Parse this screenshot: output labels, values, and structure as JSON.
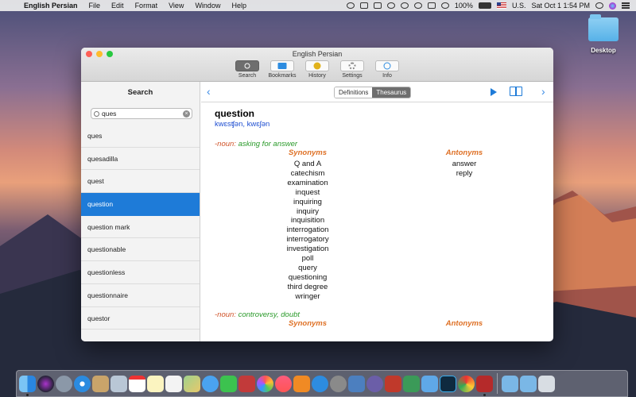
{
  "menubar": {
    "app_name": "English Persian",
    "menus": [
      "File",
      "Edit",
      "Format",
      "View",
      "Window",
      "Help"
    ],
    "battery": "100%",
    "input_source": "U.S.",
    "clock": "Sat Oct 1  1:54 PM"
  },
  "desktop": {
    "folder_label": "Desktop"
  },
  "window": {
    "title": "English Persian",
    "toolbar": [
      {
        "label": "Search",
        "icon": "search-icon"
      },
      {
        "label": "Bookmarks",
        "icon": "bookmarks-icon"
      },
      {
        "label": "History",
        "icon": "history-icon"
      },
      {
        "label": "Settings",
        "icon": "settings-icon"
      },
      {
        "label": "Info",
        "icon": "info-icon"
      }
    ],
    "sidebar": {
      "title": "Search",
      "search_value": "ques",
      "items": [
        "ques",
        "quesadilla",
        "quest",
        "question",
        "question mark",
        "questionable",
        "questionless",
        "questionnaire",
        "questor"
      ],
      "selected": "question"
    },
    "segments": [
      "Definitions",
      "Thesaurus"
    ],
    "active_segment": "Thesaurus",
    "entry": {
      "headword": "question",
      "pronunciation": "kwɛsʧən, kwɛʃən",
      "senses": [
        {
          "pos": "-noun:",
          "sense": "asking for answer",
          "synonyms_label": "Synonyms",
          "antonyms_label": "Antonyms",
          "synonyms": "Q and A\ncatechism\nexamination\ninquest\ninquiring\ninquiry\ninquisition\ninterrogation\ninterrogatory\ninvestigation\npoll\nquery\nquestioning\nthird degree\nwringer",
          "antonyms": "answer\nreply"
        },
        {
          "pos": "-noun:",
          "sense": "controversy, doubt",
          "synonyms_label": "Synonyms",
          "antonyms_label": "Antonyms"
        }
      ]
    }
  },
  "colors": {
    "accent": "#1e7bd8",
    "pos": "#d0542a",
    "sense": "#2a9a2a",
    "colhead": "#de6f23",
    "pron": "#1f4fd1"
  }
}
